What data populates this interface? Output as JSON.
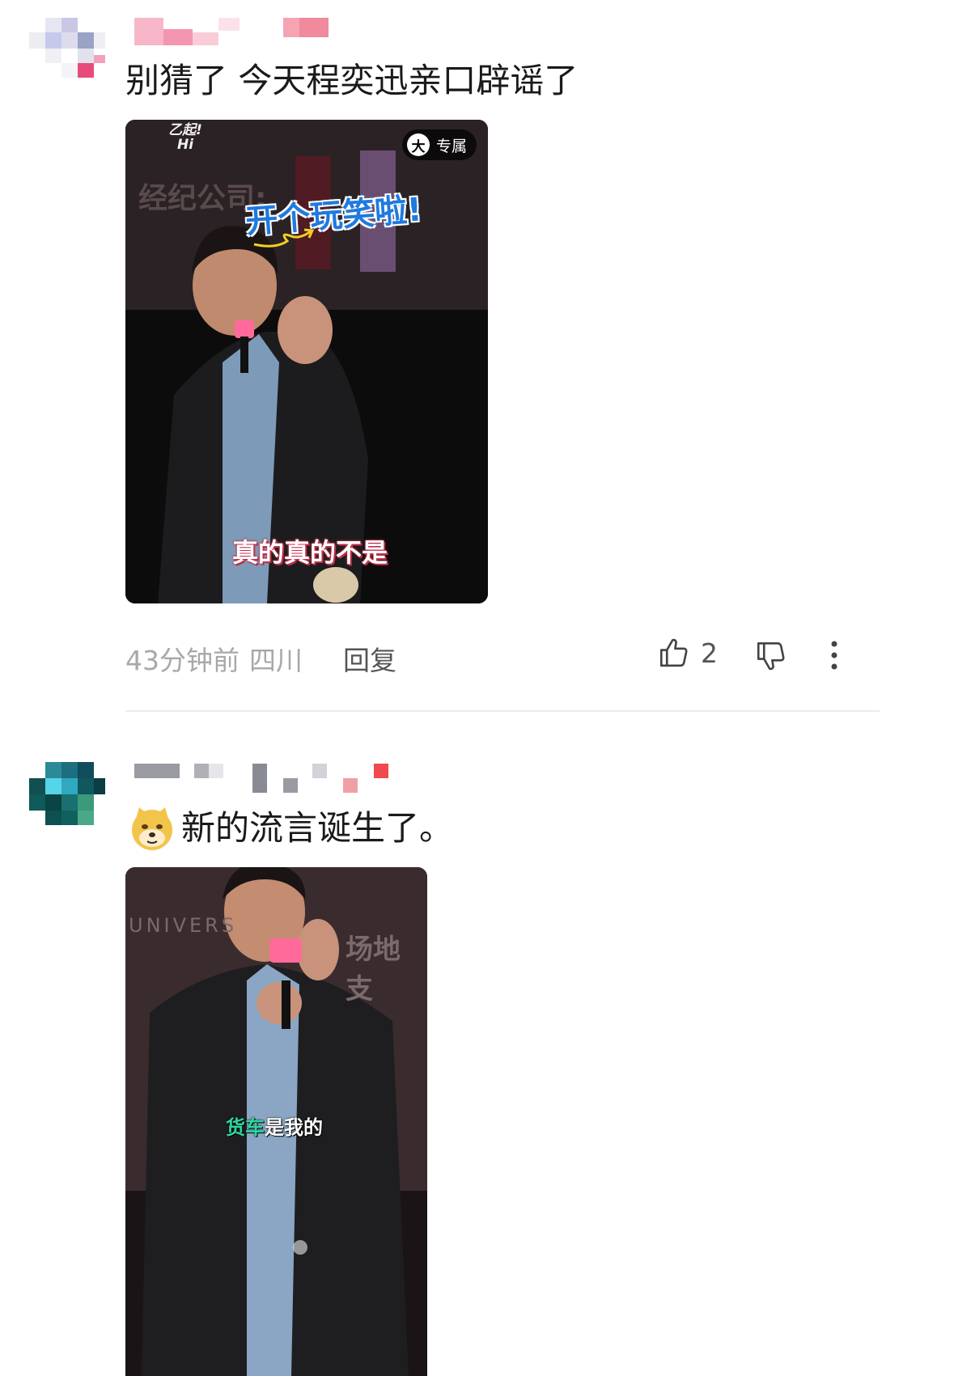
{
  "comments": [
    {
      "text": "别猜了  今天程奕迅亲口辟谣了",
      "video": {
        "badge_label": "专属",
        "badge_icon": "大",
        "logo_text": "乙起! Hi",
        "bg_text": "经纪公司:",
        "headline": "开个玩笑啦!",
        "caption": "真的真的不是"
      },
      "time": "43分钟前",
      "location": "四川",
      "reply_label": "回复",
      "like_count": "2"
    },
    {
      "emoji_icon": "doge-emoji-icon",
      "text": "新的流言诞生了。",
      "video": {
        "bg_text_left": "UNIVERS",
        "bg_text_right": "场地支",
        "caption_highlight": "货车",
        "caption_rest": "是我的"
      }
    }
  ],
  "colors": {
    "muted": "#a8a8a8",
    "divider": "#ececec",
    "headline_blue": "#1f7ae0",
    "caption_green": "#2fd6a0"
  }
}
